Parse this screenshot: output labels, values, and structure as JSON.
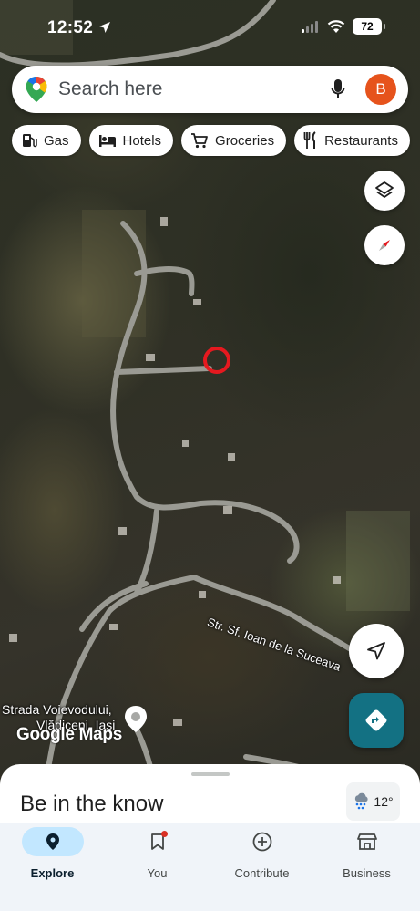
{
  "status_bar": {
    "time": "12:52",
    "battery": "72"
  },
  "search": {
    "placeholder": "Search here",
    "avatar_initial": "B"
  },
  "chips": [
    {
      "label": "Gas",
      "icon": "gas-station-icon"
    },
    {
      "label": "Hotels",
      "icon": "bed-icon"
    },
    {
      "label": "Groceries",
      "icon": "cart-icon"
    },
    {
      "label": "Restaurants",
      "icon": "fork-knife-icon"
    }
  ],
  "map": {
    "street_label_1": "Str. Sf. Ioan de la Suceava",
    "place_label_line1": "Strada Voievodului,",
    "place_label_line2": "Vlădiceni, Iasi",
    "attribution": "Google Maps",
    "marker_color": "#e5191f"
  },
  "sheet": {
    "title": "Be in the know",
    "weather_temp": "12°"
  },
  "nav": [
    {
      "label": "Explore",
      "icon": "pin-icon",
      "active": true
    },
    {
      "label": "You",
      "icon": "bookmark-icon",
      "active": false
    },
    {
      "label": "Contribute",
      "icon": "plus-circle-icon",
      "active": false
    },
    {
      "label": "Business",
      "icon": "store-icon",
      "active": false
    }
  ],
  "colors": {
    "accent": "#c2e7ff",
    "directions_button": "#137183",
    "avatar": "#e6531c"
  }
}
